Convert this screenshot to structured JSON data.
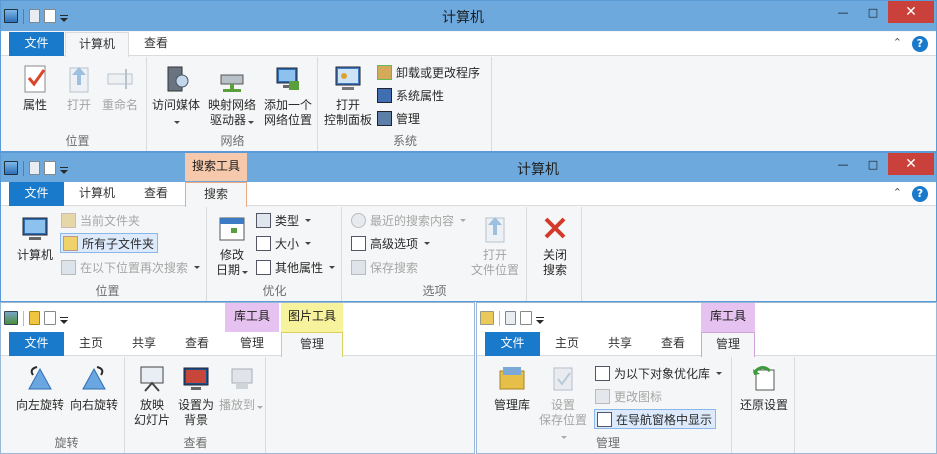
{
  "win1": {
    "title": "计算机",
    "tabs": [
      "文件",
      "计算机",
      "查看"
    ],
    "groups": {
      "location": "位置",
      "network": "网络",
      "system": "系统"
    },
    "buttons": {
      "properties": "属性",
      "open": "打开",
      "rename": "重命名",
      "media_l1": "访问媒体",
      "map_l1": "映射网络",
      "map_l2": "驱动器",
      "addloc_l1": "添加一个",
      "addloc_l2": "网络位置",
      "cp_l1": "打开",
      "cp_l2": "控制面板",
      "uninstall": "卸载或更改程序",
      "sysprops": "系统属性",
      "manage": "管理"
    }
  },
  "win2": {
    "title": "计算机",
    "context": "搜索工具",
    "tabs": [
      "文件",
      "计算机",
      "查看",
      "搜索"
    ],
    "groups": {
      "location": "位置",
      "refine": "优化",
      "options": "选项"
    },
    "buttons": {
      "computer": "计算机",
      "current_folder": "当前文件夹",
      "all_subfolders": "所有子文件夹",
      "search_again": "在以下位置再次搜索",
      "modified_l1": "修改",
      "modified_l2": "日期",
      "kind": "类型",
      "size": "大小",
      "other": "其他属性",
      "recent": "最近的搜索内容",
      "advanced": "高级选项",
      "save_search": "保存搜索",
      "openloc_l1": "打开",
      "openloc_l2": "文件位置",
      "close_l1": "关闭",
      "close_l2": "搜索"
    }
  },
  "win3": {
    "context1": "库工具",
    "context2": "图片工具",
    "tabs": [
      "文件",
      "主页",
      "共享",
      "查看",
      "管理",
      "管理"
    ],
    "groups": {
      "rotate": "旋转",
      "view": "查看"
    },
    "buttons": {
      "rotate_left": "向左旋转",
      "rotate_right": "向右旋转",
      "slide_l1": "放映",
      "slide_l2": "幻灯片",
      "bg_l1": "设置为",
      "bg_l2": "背景",
      "playto": "播放到"
    }
  },
  "win4": {
    "context": "库工具",
    "tabs": [
      "文件",
      "主页",
      "共享",
      "查看",
      "管理"
    ],
    "groups": {
      "manage": "管理"
    },
    "buttons": {
      "manage_lib": "管理库",
      "setsave_l1": "设置",
      "setsave_l2": "保存位置",
      "optimize": "为以下对象优化库",
      "change_icon": "更改图标",
      "show_nav": "在导航窗格中显示",
      "restore": "还原设置"
    }
  },
  "colors": {
    "titlebar": "#6ea9dd",
    "file_tab": "#1979ca",
    "search_ctx": "#f6c9ad",
    "lib_ctx": "#e6c2f0",
    "pic_ctx": "#f7f29c",
    "close": "#c9413a"
  }
}
